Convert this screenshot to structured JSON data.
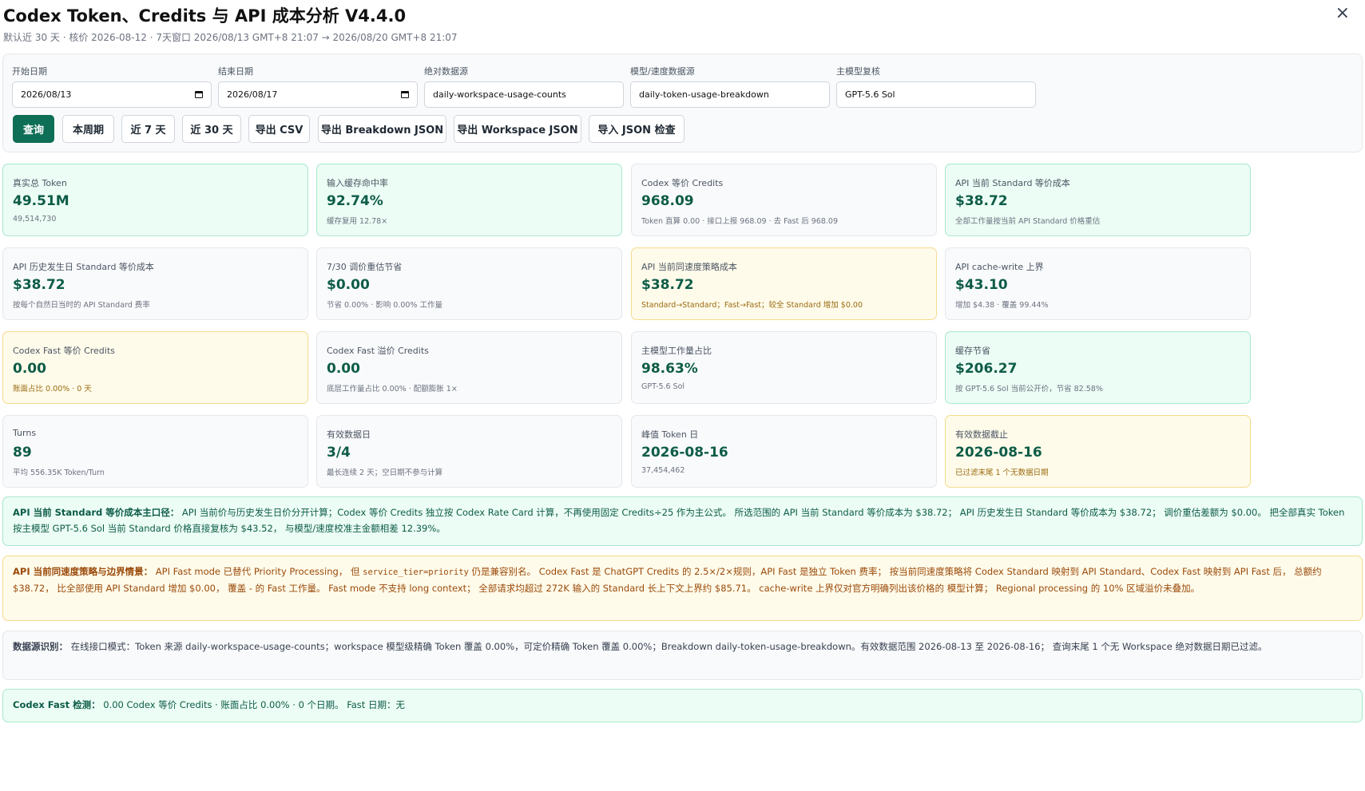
{
  "header": {
    "title": "Codex Token、Credits 与 API 成本分析 V4.4.0",
    "subtitle": "默认近 30 天 · 核价 2026-08-12 · 7天窗口 2026/08/13 GMT+8 21:07 → 2026/08/20 GMT+8 21:07",
    "close": "×"
  },
  "filters": {
    "start_label": "开始日期",
    "start_value": "2026/08/13",
    "end_label": "结束日期",
    "end_value": "2026/08/17",
    "abs_label": "绝对数据源",
    "abs_value": "daily-workspace-usage-counts",
    "model_label": "模型/速度数据源",
    "model_value": "daily-token-usage-breakdown",
    "main_label": "主模型复核",
    "main_value": "GPT-5.6 Sol"
  },
  "buttons": {
    "query": "查询",
    "this_week": "本周期",
    "last7": "近 7 天",
    "last30": "近 30 天",
    "export_csv": "导出 CSV",
    "export_breakdown": "导出 Breakdown JSON",
    "export_workspace": "导出 Workspace JSON",
    "import_json": "导入 JSON 检查"
  },
  "cards": [
    {
      "label": "真实总 Token",
      "value": "49.51M",
      "sub": "49,514,730",
      "tone": "green"
    },
    {
      "label": "输入缓存命中率",
      "value": "92.74%",
      "sub": "缓存复用 12.78×",
      "tone": "green"
    },
    {
      "label": "Codex 等价 Credits",
      "value": "968.09",
      "sub": "Token 直算 0.00 · 接口上报 968.09 · 去 Fast 后 968.09",
      "tone": "gray"
    },
    {
      "label": "API 当前 Standard 等价成本",
      "value": "$38.72",
      "sub": "全部工作量按当前 API Standard 价格重估",
      "tone": "green"
    },
    {
      "label": "API 历史发生日 Standard 等价成本",
      "value": "$38.72",
      "sub": "按每个自然日当时的 API Standard 费率",
      "tone": "gray"
    },
    {
      "label": "7/30 调价重估节省",
      "value": "$0.00",
      "sub": "节省 0.00% · 影响 0.00% 工作量",
      "tone": "gray"
    },
    {
      "label": "API 当前同速度策略成本",
      "value": "$38.72",
      "sub": "Standard→Standard；Fast→Fast；较全 Standard 增加 $0.00",
      "tone": "yellow"
    },
    {
      "label": "API cache-write 上界",
      "value": "$43.10",
      "sub": "增加 $4.38 · 覆盖 99.44%",
      "tone": "gray"
    },
    {
      "label": "Codex Fast 等价 Credits",
      "value": "0.00",
      "sub": "账面占比 0.00% · 0 天",
      "tone": "yellow"
    },
    {
      "label": "Codex Fast 溢价 Credits",
      "value": "0.00",
      "sub": "底层工作量占比 0.00% · 配额膨胀 1×",
      "tone": "gray"
    },
    {
      "label": "主模型工作量占比",
      "value": "98.63%",
      "sub": "GPT-5.6 Sol",
      "tone": "gray"
    },
    {
      "label": "缓存节省",
      "value": "$206.27",
      "sub": "按 GPT-5.6 Sol 当前公开价，节省 82.58%",
      "tone": "green"
    },
    {
      "label": "Turns",
      "value": "89",
      "sub": "平均 556.35K Token/Turn",
      "tone": "gray"
    },
    {
      "label": "有效数据日",
      "value": "3/4",
      "sub": "最长连续 2 天；空日期不参与计算",
      "tone": "gray"
    },
    {
      "label": "峰值 Token 日",
      "value": "2026-08-16",
      "sub": "37,454,462",
      "tone": "gray"
    },
    {
      "label": "有效数据截止",
      "value": "2026-08-16",
      "sub": "已过滤末尾 1 个无数据日期",
      "tone": "yellow"
    }
  ],
  "notes": {
    "n1_title": "API 当前 Standard 等价成本主口径：",
    "n1_text": "API 当前价与历史发生日价分开计算；Codex 等价 Credits 独立按 Codex Rate Card 计算，不再使用固定 Credits÷25 作为主公式。 所选范围的 API 当前 Standard 等价成本为 $38.72； API 历史发生日 Standard 等价成本为 $38.72； 调价重估差额为 $0.00。 把全部真实 Token 按主模型 GPT-5.6 Sol 当前 Standard 价格直接复核为 $43.52， 与模型/速度校准主金额相差 12.39%。",
    "n2_title": "API 当前同速度策略与边界情景：",
    "n2_text_a": "API Fast mode 已替代 Priority Processing， 但 ",
    "n2_code": "service_tier=priority",
    "n2_text_b": " 仍是兼容别名。 Codex Fast 是 ChatGPT Credits 的 2.5×/2×规则，API Fast 是独立 Token 费率； 按当前同速度策略将 Codex Standard 映射到 API Standard、Codex Fast 映射到 API Fast 后， 总额约 $38.72， 比全部使用 API Standard 增加 $0.00， 覆盖 - 的 Fast 工作量。 Fast mode 不支持 long context； 全部请求均超过 272K 输入的 Standard 长上下文上界约 $85.71。 cache-write 上界仅对官方明确列出该价格的 模型计算； Regional processing 的 10% 区域溢价未叠加。",
    "n3_title": "数据源识别：",
    "n3_text": "在线接口模式：Token 来源 daily-workspace-usage-counts；workspace 模型级精确 Token 覆盖 0.00%，可定价精确 Token 覆盖 0.00%；Breakdown daily-token-usage-breakdown。有效数据范围 2026-08-13 至 2026-08-16； 查询末尾 1 个无 Workspace 绝对数据日期已过滤。",
    "n4_title": "Codex Fast 检测：",
    "n4_text": "0.00 Codex 等价 Credits · 账面占比 0.00% · 0 个日期。 Fast 日期：无"
  }
}
